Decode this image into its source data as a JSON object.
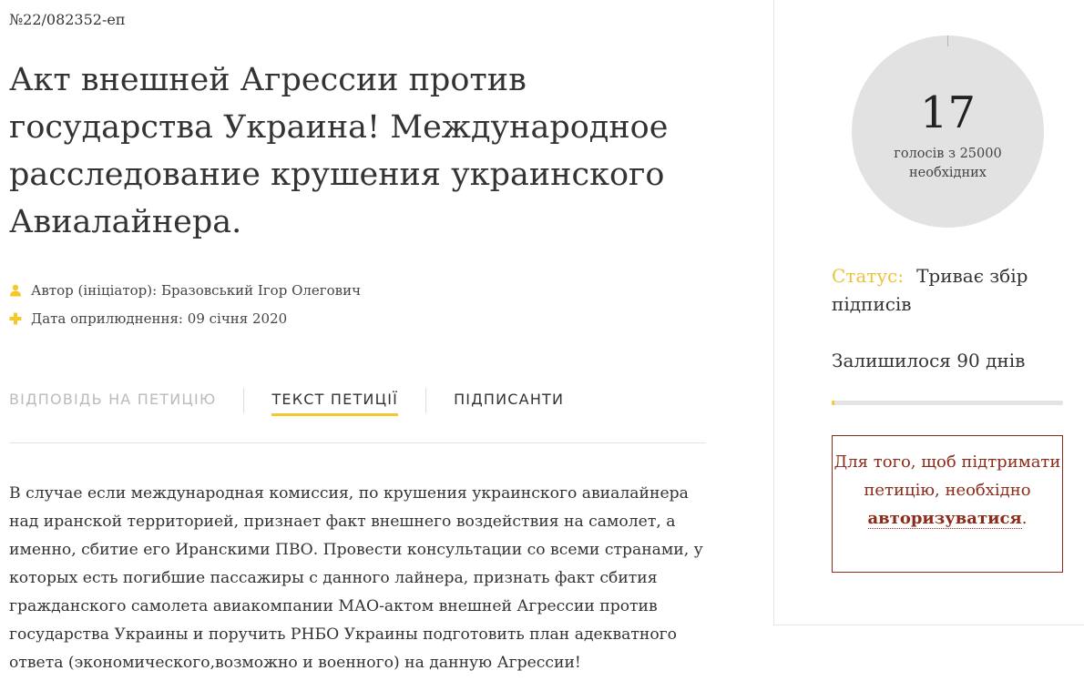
{
  "petition": {
    "number": "№22/082352-еп",
    "title": "Акт внешней Агрессии против государства Украина! Международное расследование крушения украинского Авиалайнера.",
    "author_label": "Автор (ініціатор):",
    "author_name": "Бразовський Ігор Олегович",
    "date_label": "Дата оприлюднення:",
    "date_value": "09 січня 2020",
    "text": "В случае если международная комиссия, по крушения украинского авиалайнера над иранской территорией, признает факт внешнего воздействия на самолет, а именно, сбитие его Иранскими ПВО. Провести консультации со всеми странами, у которых есть погибшие пассажиры с данного лайнера, признать факт сбития гражданского самолета авиакомпании МАО-актом внешней Агрессии против государства Украины и поручить РНБО Украины подготовить план адекватного ответа (экономического,возможно и военного) на данную Агрессии!"
  },
  "tabs": [
    {
      "label": "ВІДПОВІДЬ НА ПЕТИЦІЮ",
      "state": "disabled"
    },
    {
      "label": "ТЕКСТ ПЕТИЦІЇ",
      "state": "active"
    },
    {
      "label": "ПІДПИСАНТИ",
      "state": "normal"
    }
  ],
  "icons": {
    "author": "user-icon",
    "date": "plus-icon"
  },
  "sidebar": {
    "votes": "17",
    "votes_caption": "голосів з 25000 необхідних",
    "votes_needed": 25000,
    "status_label": "Статус:",
    "status_value": "Триває збір підписів",
    "days_left": "Залишилося 90 днів",
    "progress_fraction": 0.0007,
    "auth_text_before": "Для того, щоб підтримати петицію, необхідно",
    "auth_link": "авторизуватися",
    "auth_text_after": "."
  },
  "colors": {
    "accent_yellow": "#f5c82a",
    "status_label": "#e8c33c",
    "auth_red": "#8b2c1b",
    "circle_gray": "#e2e2e2"
  }
}
